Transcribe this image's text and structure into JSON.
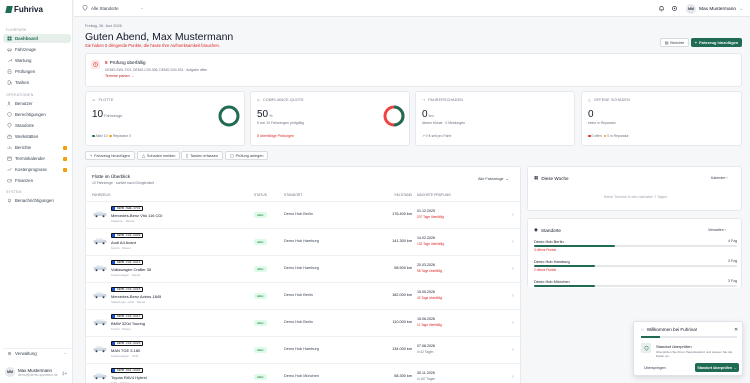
{
  "app": {
    "name": "Fuhriva"
  },
  "sidebar": {
    "sections": {
      "main": "Fuhrpark",
      "ops": "Operationen",
      "system": "System"
    },
    "items": [
      {
        "label": "Dashboard",
        "icon": "dashboard-icon"
      },
      {
        "label": "Fahrzeuge",
        "icon": "car-icon"
      },
      {
        "label": "Wartung",
        "icon": "wrench-icon"
      },
      {
        "label": "Prüfungen",
        "icon": "clipboard-icon"
      },
      {
        "label": "Tanken",
        "icon": "fuel-icon"
      },
      {
        "label": "Benutzer",
        "icon": "users-icon"
      },
      {
        "label": "Berechtigungen",
        "icon": "shield-icon"
      },
      {
        "label": "Standorte",
        "icon": "location-icon"
      },
      {
        "label": "Werkstätten",
        "icon": "tools-icon"
      },
      {
        "label": "Berichte",
        "icon": "chart-icon"
      },
      {
        "label": "Terminkalender",
        "icon": "calendar-icon"
      },
      {
        "label": "Kostenprognose",
        "icon": "trend-icon"
      },
      {
        "label": "Finanzen",
        "icon": "wallet-icon"
      },
      {
        "label": "Benachrichtigungen",
        "icon": "bell-icon"
      }
    ],
    "verwaltung": "Verwaltung",
    "user": {
      "initials": "MM",
      "name": "Max Mustermann",
      "email": "demo@demo-spedition.de"
    }
  },
  "topbar": {
    "location_select": "Alle Standorte",
    "user": {
      "initials": "MM",
      "name": "Max Mustermann"
    }
  },
  "header": {
    "date": "Freitag, 26. Juni 2026",
    "greeting": "Guten Abend, Max Mustermann",
    "alert": "Sie haben 5 dringende Punkte, die heute Ihre Aufmerksamkeit brauchen.",
    "reports_button": "Berichte",
    "add_vehicle_button": "Fahrzeug hinzufügen"
  },
  "task": {
    "count": "5",
    "title": "Prüfung überfällig",
    "plates": "DEMO-SWL-FC0, DEMO-C00-306, DEMO-S04-931 · Aufgabe offen",
    "link": "Termine planen →"
  },
  "kpis": {
    "fleet": {
      "label": "Flotte",
      "value": "10",
      "unit": "Fahrzeuge",
      "legend_active": "Aktiv 10",
      "legend_repair": "Reparatur 0",
      "ring_fraction": 1.0
    },
    "compliance": {
      "label": "Compliance-Quote",
      "value": "50",
      "unit": "%",
      "sub": "5 von 10 Fahrzeugen prüfgültig",
      "alert": "5 überfällige Prüfungen",
      "ring_fraction": 0.5
    },
    "damages": {
      "label": "Fahrerschäden",
      "value": "0",
      "unit": "km",
      "sub": "diesen Monat · 0 Meldungen",
      "foot": "↗ 0 € seit pro Fahrt"
    },
    "open": {
      "label": "Offene Schäden",
      "value": "0",
      "sub": "keine in Reparatur",
      "legend_open": "0 offen",
      "legend_repair": "0 in Reparatur"
    }
  },
  "quick_actions": [
    "Fahrzeug hinzufügen",
    "Schaden melden",
    "Tanken erfassen",
    "Prüfung anlegen"
  ],
  "fleet_table": {
    "title": "Flotte im Überblick",
    "subtitle": "10 Fahrzeuge · sortiert nach Dringlichkeit",
    "filter": "Alle Fahrzeuge",
    "columns": [
      "Fahrzeug",
      "Status",
      "Standort",
      "km-Stand",
      "Nächste Prüfung"
    ],
    "rows": [
      {
        "plate": "DEMO-SWB-4732",
        "model": "Mercedes-Benz Vito 116 CDI",
        "sub": "Kastenw. · Diesel",
        "status": "Aktiv",
        "station": "Demo Hub Berlin",
        "km": "176.400 km",
        "date": "01.12.2025",
        "note": "207 Tage überfällig"
      },
      {
        "plate": "DEMO-C38-8809",
        "model": "Audi A4 Avant",
        "sub": "Kombi · Diesel",
        "status": "Aktiv",
        "station": "Demo Hub Hamburg",
        "km": "141.300 km",
        "date": "14.02.2026",
        "note": "132 Tage überfällig"
      },
      {
        "plate": "DEMO-C38-8811",
        "model": "Volkswagen Crafter 35",
        "sub": "Kastenwagen · Diesel",
        "status": "Aktiv",
        "station": "Demo Hub Hamburg",
        "km": "98.500 km",
        "date": "20.03.2026",
        "note": "98 Tage überfällig"
      },
      {
        "plate": "DEMO-C38-8815",
        "model": "Mercedes-Benz Actros 1845",
        "sub": "Sattelzugm. LKW · Diesel",
        "status": "Aktiv",
        "station": "Demo Hub Berlin",
        "km": "182.000 km",
        "date": "15.05.2026",
        "note": "42 Tage überfällig"
      },
      {
        "plate": "DEMO-C38-8817",
        "model": "BMW 320d Touring",
        "sub": "Kombi · Diesel",
        "status": "Aktiv",
        "station": "Demo Hub Berlin",
        "km": "110.000 km",
        "date": "15.06.2026",
        "note": "11 Tage überfällig"
      },
      {
        "plate": "DEMO-C38-8820",
        "model": "MAN TGE 3.180",
        "sub": "Kastenwagen · LKW",
        "status": "Aktiv",
        "station": "Demo Hub Hamburg",
        "km": "134.000 km",
        "date": "07.08.2026",
        "note": "in 42 Tagen",
        "ok": true
      },
      {
        "plate": "DEMO-S04-8801",
        "model": "Toyota RAV4 Hybrid",
        "sub": "SUV · Hybrid",
        "status": "Aktiv",
        "station": "Demo Hub München",
        "km": "58.300 km",
        "date": "30.11.2026",
        "note": "in 157 Tagen",
        "ok": true
      }
    ]
  },
  "week": {
    "title": "Diese Woche",
    "link": "Kalender",
    "empty": "Keine Termine in den nächsten 7 Tagen"
  },
  "locations": {
    "title": "Standorte",
    "link": "Verwalten",
    "items": [
      {
        "name": "Demo Hub Berlin",
        "count": "4 Fzg",
        "share": 0.4,
        "warn": "3 offene Punkte"
      },
      {
        "name": "Demo Hub Hamburg",
        "count": "3 Fzg",
        "share": 0.3,
        "warn": "2 offene Punkte"
      },
      {
        "name": "Demo Hub München",
        "count": "3 Fzg",
        "share": 0.3,
        "warn": ""
      }
    ]
  },
  "welcome": {
    "title": "Willkommen bei Fuhriva!",
    "progress": 0.2,
    "step_title": "Standort überprüfen",
    "step_desc": "Überprüfen Sie Ihren Hauptstandort und passen Sie die Daten an.",
    "skip": "Überspringen",
    "cta": "Standort überprüfen →"
  },
  "colors": {
    "brand": "#1f6b53",
    "alert": "#dc2626",
    "ok_bg": "#dcfce7"
  }
}
